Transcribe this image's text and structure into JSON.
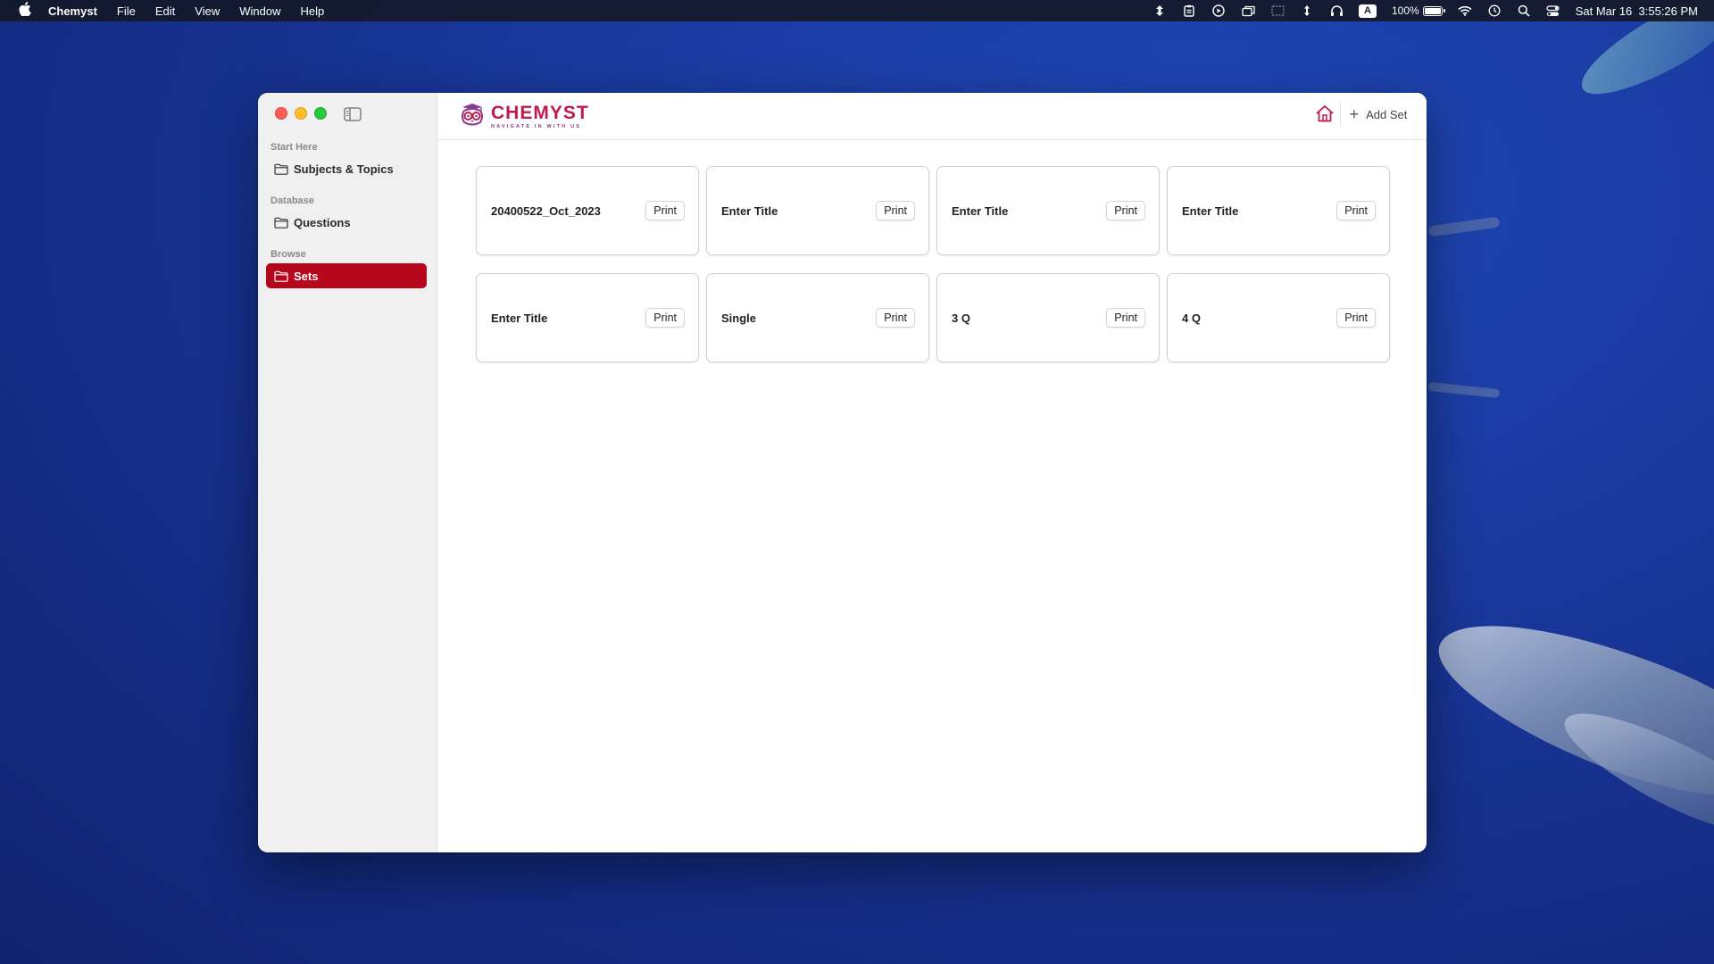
{
  "menubar": {
    "app_name": "Chemyst",
    "menus": [
      "File",
      "Edit",
      "View",
      "Window",
      "Help"
    ],
    "battery_percent": "100%",
    "battery_level": 1.0,
    "datetime": "Sat Mar 16  3:55:26 PM",
    "keyboard_input": "A",
    "status_icons": [
      "sync-icon",
      "clipboard-icon",
      "play-icon",
      "window-icon",
      "screen-icon",
      "arrow-updown-icon",
      "headphones-icon",
      "keyboard-input-icon",
      "battery-icon",
      "wifi-icon",
      "clock-icon",
      "spotlight-search-icon",
      "control-center-icon"
    ]
  },
  "sidebar": {
    "sections": [
      {
        "header": "Start Here",
        "items": [
          {
            "label": "Subjects & Topics",
            "icon": "folder-icon",
            "active": false
          }
        ]
      },
      {
        "header": "Database",
        "items": [
          {
            "label": "Questions",
            "icon": "folder-icon",
            "active": false
          }
        ]
      },
      {
        "header": "Browse",
        "items": [
          {
            "label": "Sets",
            "icon": "folder-icon",
            "active": true
          }
        ]
      }
    ]
  },
  "toolbar": {
    "logo_name": "CHEMYST",
    "logo_tagline": "NAVIGATE IN WITH US",
    "add_set_label": "Add Set"
  },
  "colors": {
    "accent": "#b5061c",
    "logo_primary": "#c0194b",
    "logo_secondary": "#8a3a8c"
  },
  "sets": [
    {
      "title": "20400522_Oct_2023",
      "print_label": "Print"
    },
    {
      "title": "Enter Title",
      "print_label": "Print"
    },
    {
      "title": "Enter Title",
      "print_label": "Print"
    },
    {
      "title": "Enter Title",
      "print_label": "Print"
    },
    {
      "title": "Enter Title",
      "print_label": "Print"
    },
    {
      "title": "Single",
      "print_label": "Print"
    },
    {
      "title": "3 Q",
      "print_label": "Print"
    },
    {
      "title": "4 Q",
      "print_label": "Print"
    }
  ]
}
